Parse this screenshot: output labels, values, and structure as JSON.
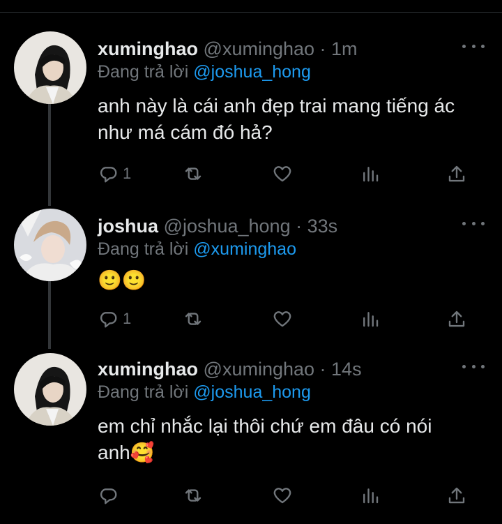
{
  "tweets": [
    {
      "name": "xuminghao",
      "handle": "@xuminghao",
      "time": "· 1m",
      "replying_prefix": "Đang trả lời",
      "replying_to": "@joshua_hong",
      "text_line1": "anh này là cái anh đẹp trai mang tiếng ác",
      "text_line2": "như má cám đó hả?",
      "reply_count": "1"
    },
    {
      "name": "joshua",
      "handle": "@joshua_hong",
      "time": "· 33s",
      "replying_prefix": "Đang trả lời",
      "replying_to": "@xuminghao",
      "text_line1": "🙂🙂",
      "reply_count": "1"
    },
    {
      "name": "xuminghao",
      "handle": "@xuminghao",
      "time": "· 14s",
      "replying_prefix": "Đang trả lời",
      "replying_to": "@joshua_hong",
      "text_line1": "em chỉ nhắc lại thôi chứ em đâu có nói",
      "text_line2": "anh🥰",
      "reply_count": ""
    }
  ],
  "colors": {
    "background": "#000000",
    "text": "#e7e9ea",
    "secondary": "#71767b",
    "mention": "#1d9bf0",
    "thread_line": "#333639"
  },
  "icons": [
    "more-icon",
    "reply-icon",
    "retweet-icon",
    "like-icon",
    "views-icon",
    "share-icon"
  ]
}
